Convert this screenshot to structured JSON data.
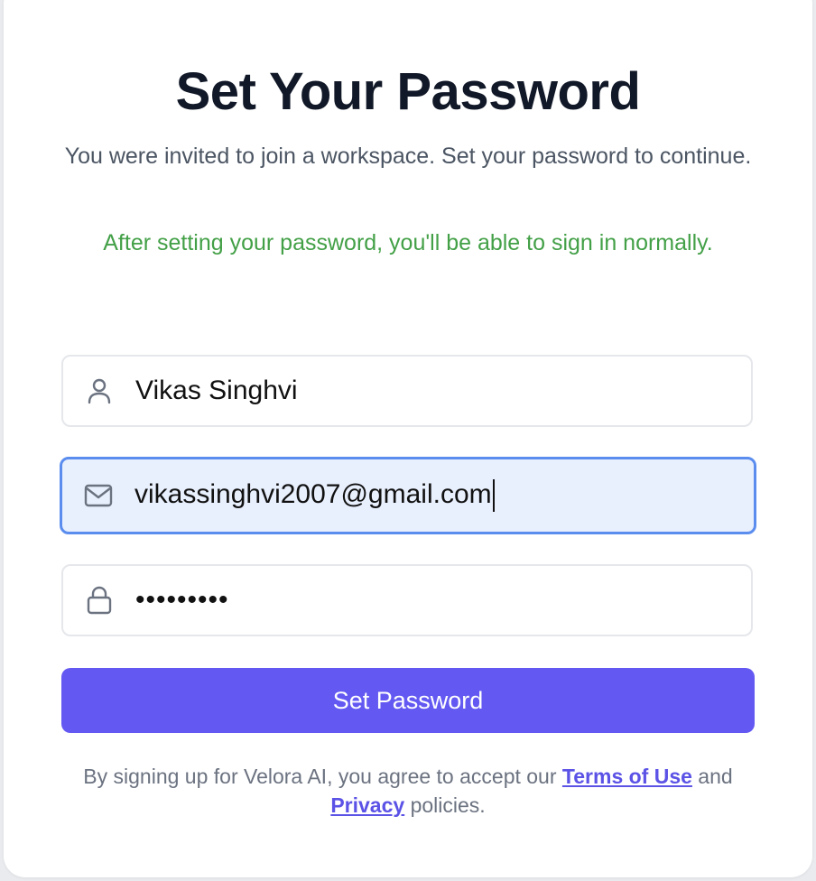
{
  "page": {
    "title": "Set Your Password",
    "subtitle": "You were invited to join a workspace. Set your password to continue.",
    "note": "After setting your password, you'll be able to sign in normally."
  },
  "form": {
    "name": {
      "value": "Vikas Singhvi",
      "icon": "user-icon"
    },
    "email": {
      "value": "vikassinghvi2007@gmail.com",
      "icon": "mail-icon"
    },
    "password": {
      "masked_value": "•••••••••",
      "icon": "lock-icon"
    },
    "submit_label": "Set Password"
  },
  "footer": {
    "prefix": "By signing up for Velora AI, you agree to accept our ",
    "terms_label": "Terms of Use",
    "middle": " and ",
    "privacy_label": "Privacy",
    "suffix": " policies."
  },
  "colors": {
    "accent": "#6359f2",
    "note_green": "#43a047",
    "focus_border": "#5b8def",
    "focus_bg": "#e8effd"
  }
}
